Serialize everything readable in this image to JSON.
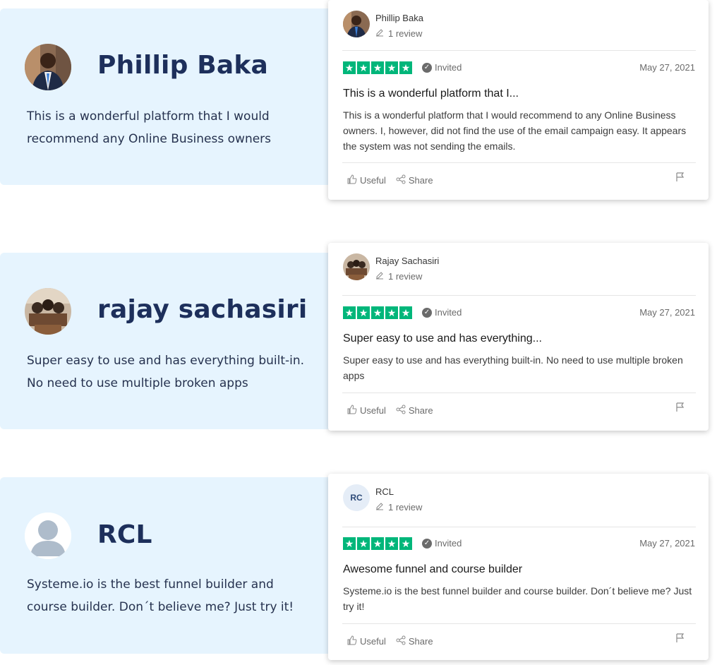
{
  "reviews": [
    {
      "name": "Phillip Baka",
      "quote": "This is a wonderful platform that I would recommend any Online Business owners",
      "card": {
        "name": "Phillip Baka",
        "count": "1 review",
        "invited": "Invited",
        "date": "May 27, 2021",
        "title": "This is a wonderful platform that I...",
        "body": "This is a wonderful platform that I would recommend to any Online Business owners. I, however, did not find the use of the email campaign easy. It appears the system was not sending the emails.",
        "useful": "Useful",
        "share": "Share",
        "rating": 5
      }
    },
    {
      "name": "rajay sachasiri",
      "quote": "Super easy to use and has everything built-in. No need to use multiple broken apps",
      "card": {
        "name": "Rajay Sachasiri",
        "count": "1 review",
        "invited": "Invited",
        "date": "May 27, 2021",
        "title": "Super easy to use and has everything...",
        "body": "Super easy to use and has everything built-in. No need to use multiple broken apps",
        "useful": "Useful",
        "share": "Share",
        "rating": 5
      }
    },
    {
      "name": "RCL",
      "quote": "Systeme.io is the best funnel builder and course builder. Don´t believe me? Just try it!",
      "card": {
        "name": "RCL",
        "initials": "RC",
        "count": "1 review",
        "invited": "Invited",
        "date": "May 27, 2021",
        "title": "Awesome funnel and course builder",
        "body": "Systeme.io is the best funnel builder and course builder. Don´t believe me? Just try it!",
        "useful": "Useful",
        "share": "Share",
        "rating": 5
      }
    }
  ],
  "colors": {
    "star": "#00b67a",
    "name": "#1d2f5b",
    "panel": "#e6f4fe"
  }
}
